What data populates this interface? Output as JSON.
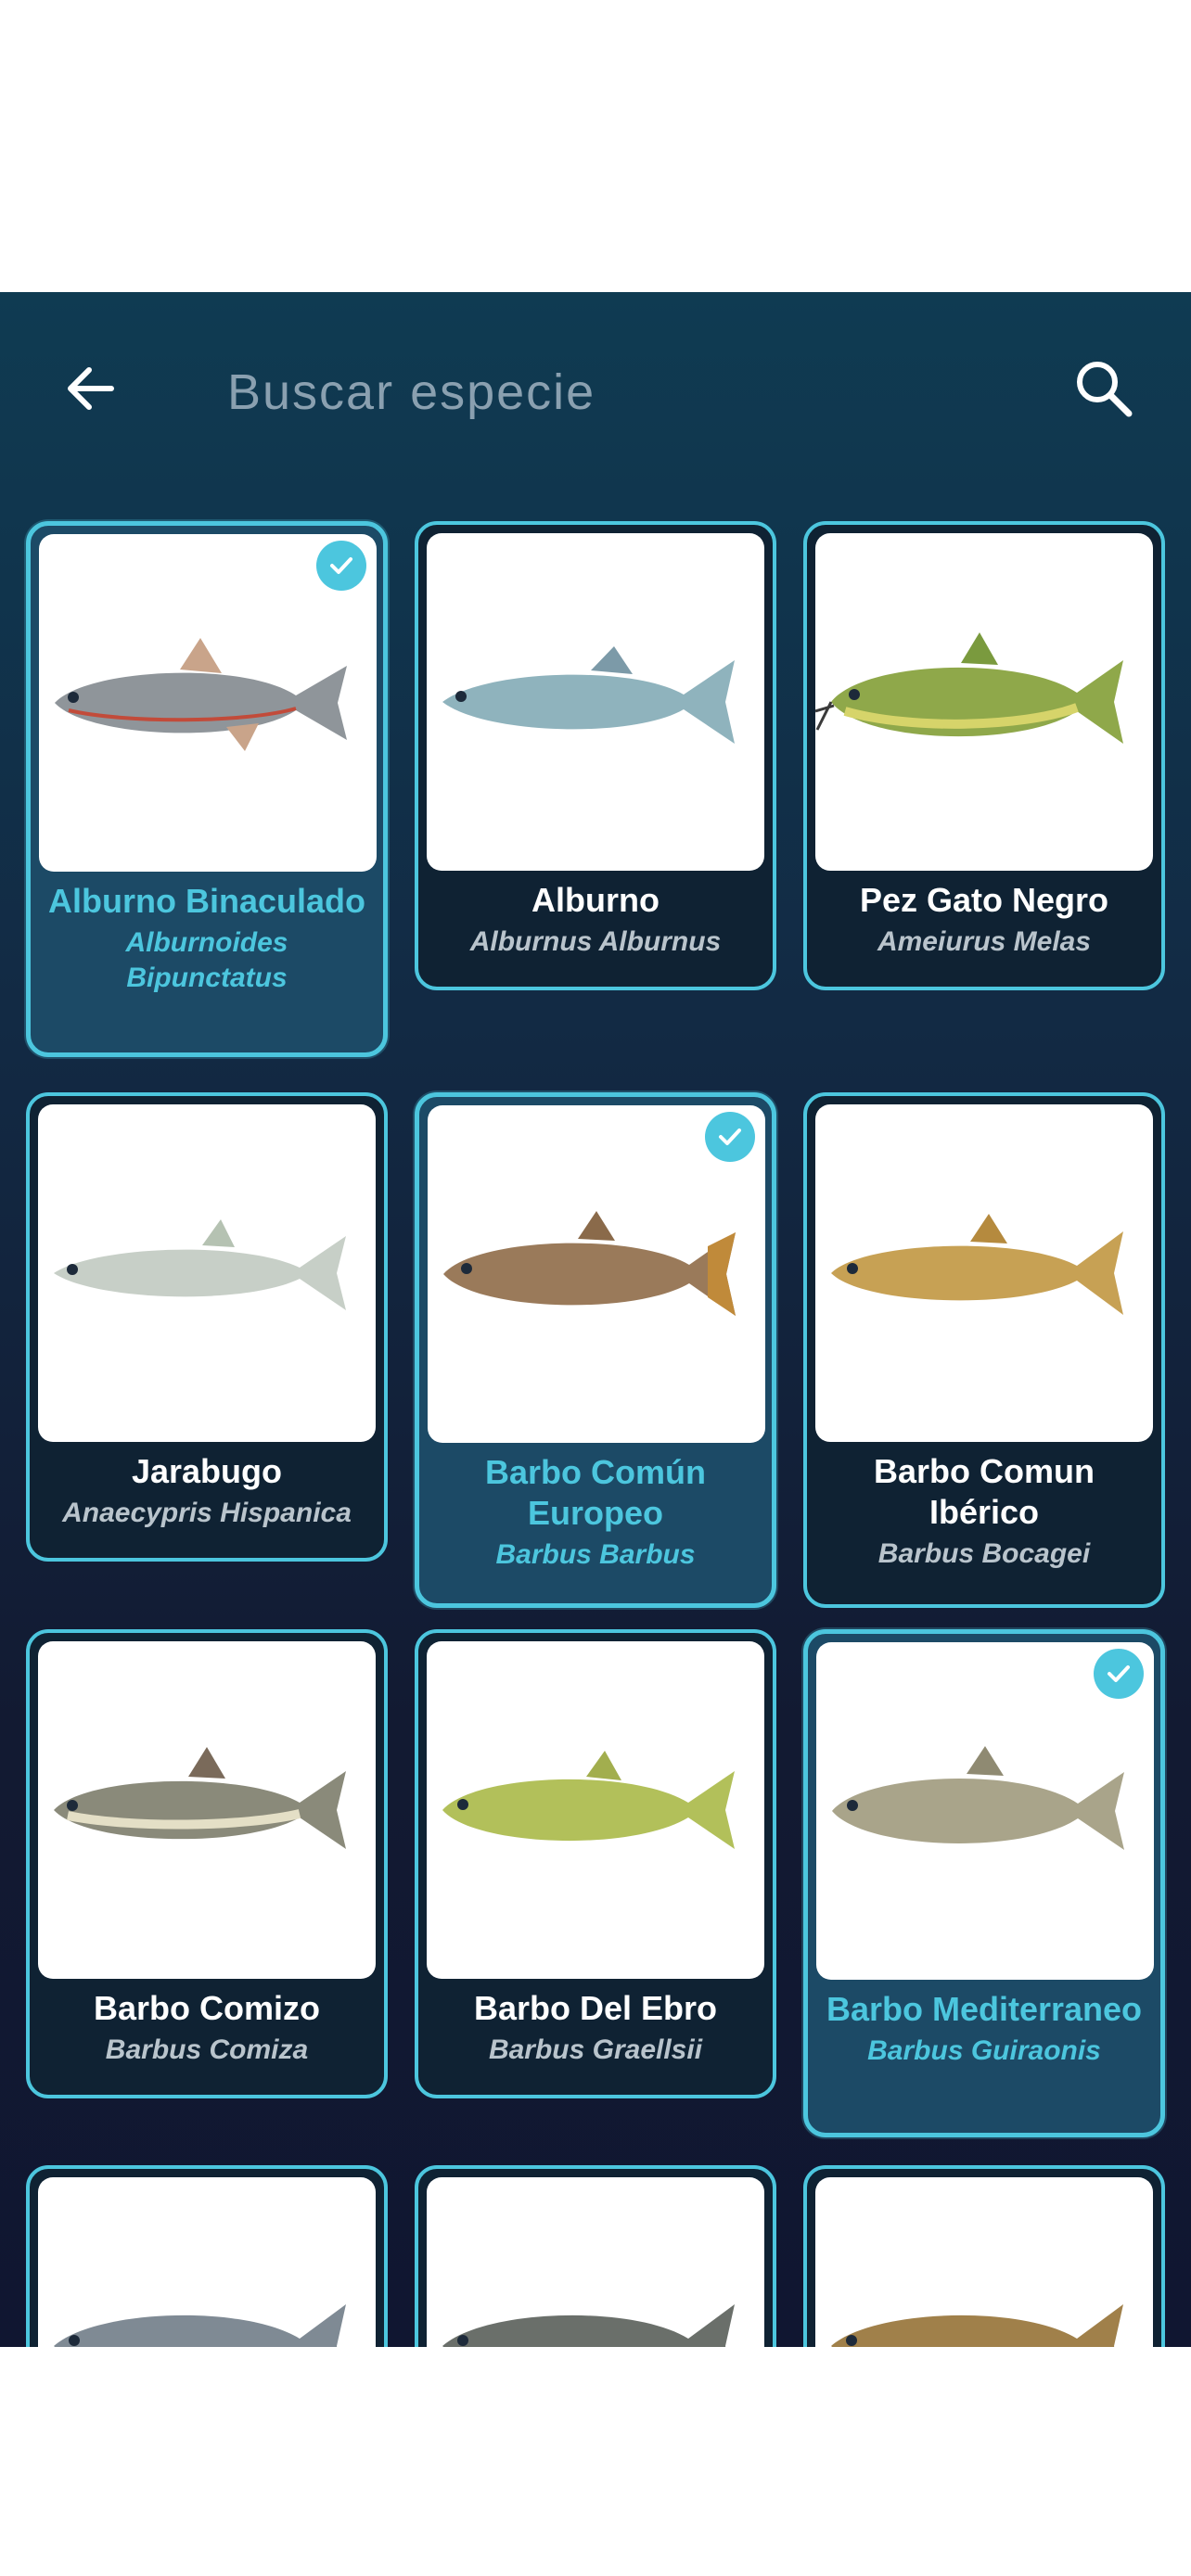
{
  "search": {
    "placeholder": "Buscar especie",
    "value": ""
  },
  "icons": {
    "back": "back-arrow-icon",
    "search": "search-icon",
    "check": "check-icon"
  },
  "colors": {
    "accent": "#4cc6de",
    "card_bg": "#0f2233",
    "selected_bg": "#1c4a66",
    "header_bg": "#0f3b52"
  },
  "species": [
    {
      "common": "Alburno Binaculado",
      "scientific": "Alburnoides Bipunctatus",
      "selected": true
    },
    {
      "common": "Alburno",
      "scientific": "Alburnus Alburnus",
      "selected": false
    },
    {
      "common": "Pez Gato Negro",
      "scientific": "Ameiurus Melas",
      "selected": false
    },
    {
      "common": "Jarabugo",
      "scientific": "Anaecypris Hispanica",
      "selected": false
    },
    {
      "common": "Barbo Común Europeo",
      "scientific": "Barbus Barbus",
      "selected": true
    },
    {
      "common": "Barbo Comun Ibérico",
      "scientific": "Barbus Bocagei",
      "selected": false
    },
    {
      "common": "Barbo Comizo",
      "scientific": "Barbus Comiza",
      "selected": false
    },
    {
      "common": "Barbo Del Ebro",
      "scientific": "Barbus Graellsii",
      "selected": false
    },
    {
      "common": "Barbo Mediterraneo",
      "scientific": "Barbus Guiraonis",
      "selected": true
    }
  ]
}
